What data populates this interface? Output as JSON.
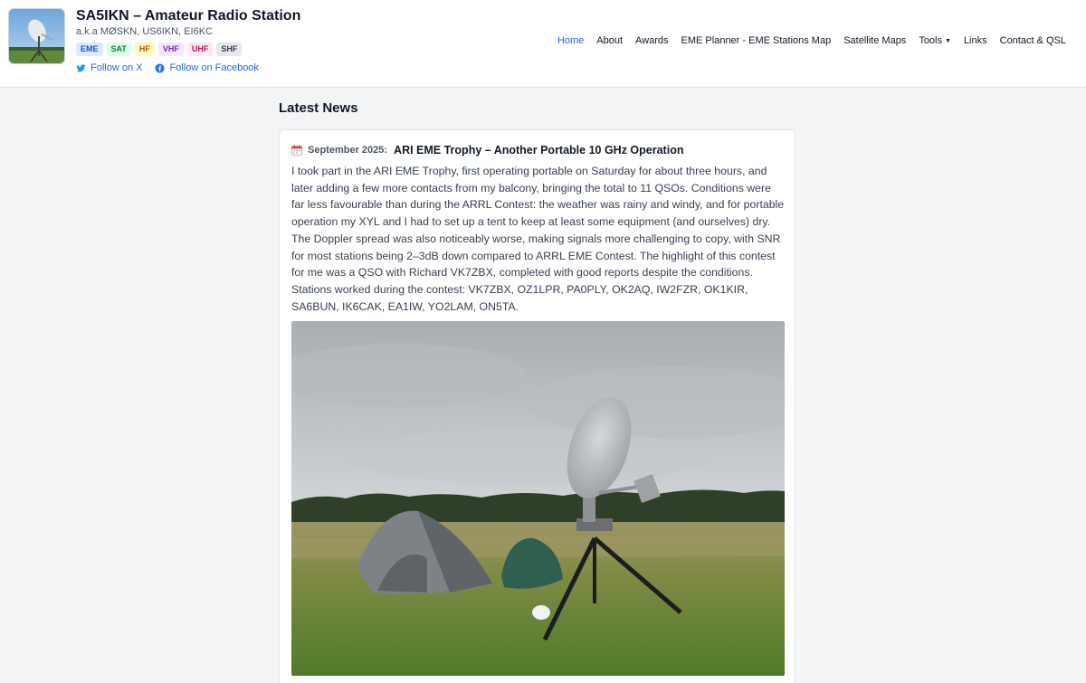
{
  "site": {
    "title": "SA5IKN – Amateur Radio Station",
    "aka": "a.k.a MØSKN, US6IKN, EI6KC",
    "badges": [
      {
        "label": "EME",
        "bg": "#dbeafe",
        "fg": "#1d4ed8"
      },
      {
        "label": "SAT",
        "bg": "#dcfce7",
        "fg": "#15803d"
      },
      {
        "label": "HF",
        "bg": "#fef9c3",
        "fg": "#a16207"
      },
      {
        "label": "VHF",
        "bg": "#f3e8ff",
        "fg": "#7e22ce"
      },
      {
        "label": "UHF",
        "bg": "#fce7f3",
        "fg": "#be185d"
      },
      {
        "label": "SHF",
        "bg": "#e5e7eb",
        "fg": "#374151"
      }
    ],
    "social": {
      "x_label": "Follow on X",
      "facebook_label": "Follow on Facebook"
    }
  },
  "nav": {
    "items": [
      "Home",
      "About",
      "Awards",
      "EME Planner - EME Stations Map",
      "Satellite Maps",
      "Tools",
      "Links",
      "Contact & QSL"
    ],
    "active": "Home"
  },
  "main": {
    "section_title": "Latest News",
    "post": {
      "date": "September 2025:",
      "title": "ARI EME Trophy – Another Portable 10 GHz Operation",
      "body": "I took part in the ARI EME Trophy, first operating portable on Saturday for about three hours, and later adding a few more contacts from my balcony, bringing the total to 11 QSOs. Conditions were far less favourable than during the ARRL Contest: the weather was rainy and windy, and for portable operation my XYL and I had to set up a tent to keep at least some equipment (and ourselves) dry. The Doppler spread was also noticeably worse, making signals more challenging to copy, with SNR for most stations being 2–3dB down compared to ARRL EME Contest. The highlight of this contest for me was a QSO with Richard VK7ZBX, completed with good reports despite the conditions. Stations worked during the contest: VK7ZBX, OZ1LPR, PA0PLY, OK2AQ, IW2FZR, OK1KIR, SA6BUN, IK6CAK, EA1IW, YO2LAM, ON5TA."
    }
  },
  "colors": {
    "accent": "#2563eb",
    "background": "#f3f4f6"
  }
}
